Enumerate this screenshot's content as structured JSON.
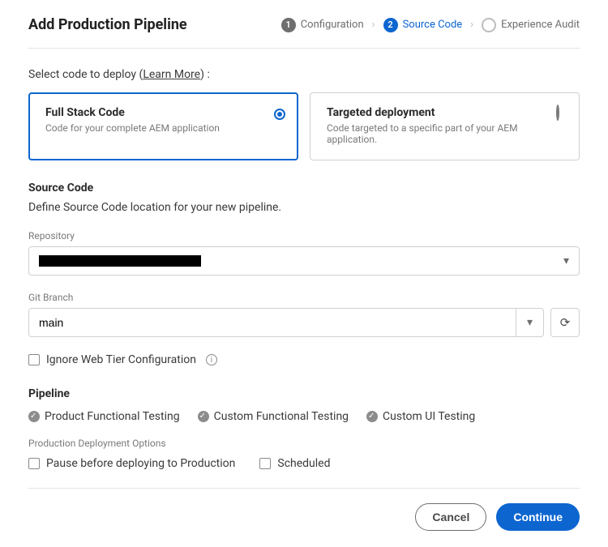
{
  "header": {
    "title": "Add Production Pipeline",
    "steps": [
      {
        "num": "1",
        "label": "Configuration",
        "state": "done"
      },
      {
        "num": "2",
        "label": "Source Code",
        "state": "active"
      },
      {
        "num": "",
        "label": "Experience Audit",
        "state": "future"
      }
    ]
  },
  "prompt": {
    "text": "Select code to deploy  (",
    "learn_more": "Learn More",
    "suffix": ") :"
  },
  "deploy_options": [
    {
      "title": "Full Stack Code",
      "desc": "Code for your complete AEM application",
      "selected": true
    },
    {
      "title": "Targeted deployment",
      "desc": "Code targeted to a specific part of your AEM application.",
      "selected": false
    }
  ],
  "source_code": {
    "heading": "Source Code",
    "description": "Define Source Code location for your new pipeline.",
    "repository_label": "Repository",
    "repository_value": "",
    "branch_label": "Git Branch",
    "branch_value": "main",
    "ignore_web_tier_label": "Ignore Web Tier Configuration"
  },
  "pipeline": {
    "heading": "Pipeline",
    "tests": [
      "Product Functional Testing",
      "Custom Functional Testing",
      "Custom UI Testing"
    ],
    "prod_deploy_label": "Production Deployment Options",
    "options": [
      "Pause before deploying to Production",
      "Scheduled"
    ]
  },
  "footer": {
    "cancel": "Cancel",
    "continue": "Continue"
  }
}
